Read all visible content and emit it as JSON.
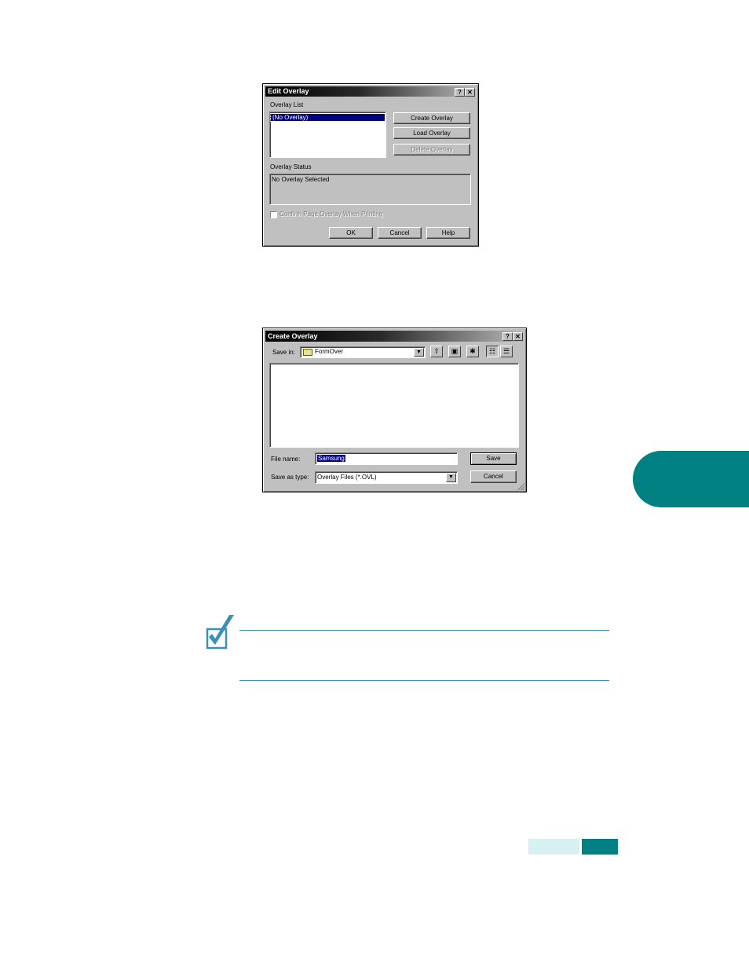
{
  "edit_overlay": {
    "title": "Edit Overlay",
    "help_glyph": "?",
    "close_glyph": "✕",
    "overlay_list_label": "Overlay List",
    "overlay_list_items": [
      "(No Overlay)"
    ],
    "create_button": "Create Overlay",
    "load_button": "Load Overlay",
    "delete_button": "Delete Overlay",
    "overlay_status_label": "Overlay Status",
    "overlay_status_text": "No Overlay Selected",
    "confirm_checkbox_label": "Confirm Page Overlay When Printing",
    "ok_button": "OK",
    "cancel_button": "Cancel",
    "help_button": "Help"
  },
  "create_overlay": {
    "title": "Create Overlay",
    "help_glyph": "?",
    "close_glyph": "✕",
    "save_in_label": "Save in:",
    "save_in_value": "FormOver",
    "file_name_label": "File name:",
    "file_name_value": "Samsung",
    "save_as_type_label": "Save as type:",
    "save_as_type_value": "Overlay Files (*.OVL)",
    "save_button": "Save",
    "cancel_button": "Cancel",
    "icons": [
      "folder-icon",
      "up-one-level-icon",
      "desktop-icon",
      "new-folder-icon",
      "list-view-icon",
      "details-view-icon"
    ]
  },
  "colors": {
    "accent_teal": "#008080",
    "accent_light": "#d7f0f0",
    "note_rule": "#3a8fb7",
    "dialog_face": "#c0c0c0",
    "selection": "#000080"
  }
}
